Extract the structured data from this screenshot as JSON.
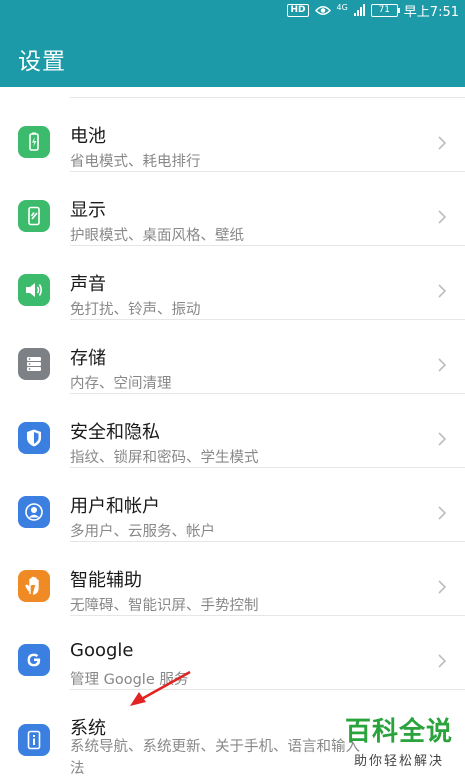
{
  "status_bar": {
    "hd_label": "HD",
    "network_label": "4G",
    "battery_level": "71",
    "time": "早上7:51"
  },
  "header": {
    "title": "设置"
  },
  "settings": {
    "items": [
      {
        "title": "电池",
        "subtitle": "省电模式、耗电排行",
        "icon": "battery-icon",
        "color": "#3dbb6c"
      },
      {
        "title": "显示",
        "subtitle": "护眼模式、桌面风格、壁纸",
        "icon": "display-icon",
        "color": "#3dbb6c"
      },
      {
        "title": "声音",
        "subtitle": "免打扰、铃声、振动",
        "icon": "sound-icon",
        "color": "#3dbb6c"
      },
      {
        "title": "存储",
        "subtitle": "内存、空间清理",
        "icon": "storage-icon",
        "color": "#7d8084"
      },
      {
        "title": "安全和隐私",
        "subtitle": "指纹、锁屏和密码、学生模式",
        "icon": "shield-icon",
        "color": "#3b7fe0"
      },
      {
        "title": "用户和帐户",
        "subtitle": "多用户、云服务、帐户",
        "icon": "user-icon",
        "color": "#3b7fe0"
      },
      {
        "title": "智能辅助",
        "subtitle": "无障碍、智能识屏、手势控制",
        "icon": "hand-icon",
        "color": "#f08a24"
      },
      {
        "title": "Google",
        "subtitle": "管理 Google 服务",
        "icon": "google-icon",
        "color": "#3b7fe0"
      },
      {
        "title": "系统",
        "subtitle": "系统导航、系统更新、关于手机、语言和输入法",
        "icon": "system-info-icon",
        "color": "#3b7fe0"
      }
    ]
  },
  "watermark": {
    "title": "百科全说",
    "subtitle": "助你轻松解决"
  },
  "colors": {
    "header": "#1c9aa7",
    "annotation_arrow": "#e32222",
    "watermark": "#2aa33c"
  }
}
